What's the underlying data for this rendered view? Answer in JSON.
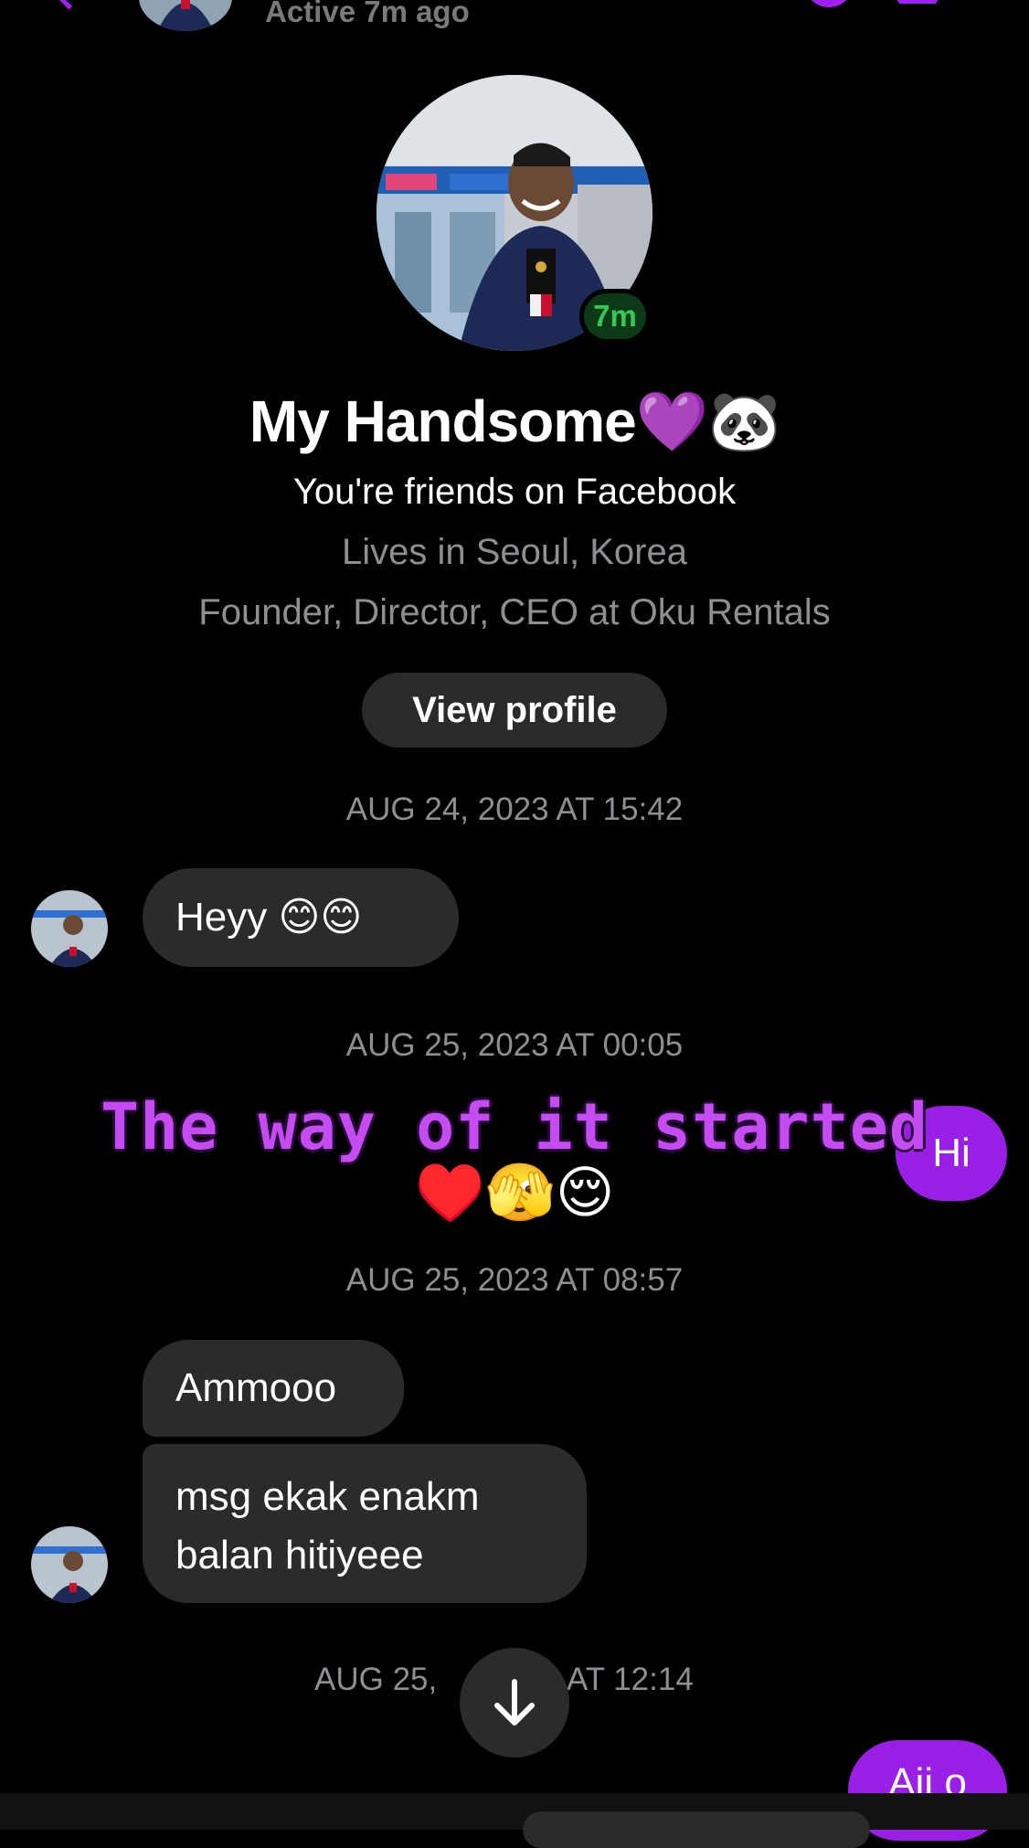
{
  "header": {
    "status": "Active 7m ago"
  },
  "profile": {
    "name": "My Handsome💜🐼",
    "active_badge": "7m",
    "friends_text": "You're friends on Facebook",
    "lives_in": "Lives in Seoul, Korea",
    "work": "Founder, Director, CEO at Oku Rentals",
    "view_profile_label": "View profile"
  },
  "messages": {
    "ts1": "AUG 24, 2023 AT 15:42",
    "msg1": "Heyy 😊😊",
    "ts2": "AUG 25, 2023 AT 00:05",
    "out1": "Hi",
    "ts3": "AUG 25, 2023 AT 08:57",
    "msg2": "Ammooo",
    "msg3_line1": "msg ekak enakm",
    "msg3_line2": "balan hitiyeee",
    "ts4_left": "AUG 25,",
    "ts4_right": "AT 12:14",
    "out2": "Aii o"
  },
  "overlay": {
    "caption": "The way of it started",
    "emojis": "♥️🫣😌"
  },
  "colors": {
    "accent": "#9b1ee6",
    "caption": "#c54cf0",
    "bubble_in": "#2b2b2b",
    "muted_text": "#8e8e93",
    "active_green": "#34c759"
  },
  "icons": {
    "back": "chevron-left-icon",
    "call": "phone-icon",
    "video": "video-icon",
    "scroll_down": "arrow-down-icon"
  }
}
